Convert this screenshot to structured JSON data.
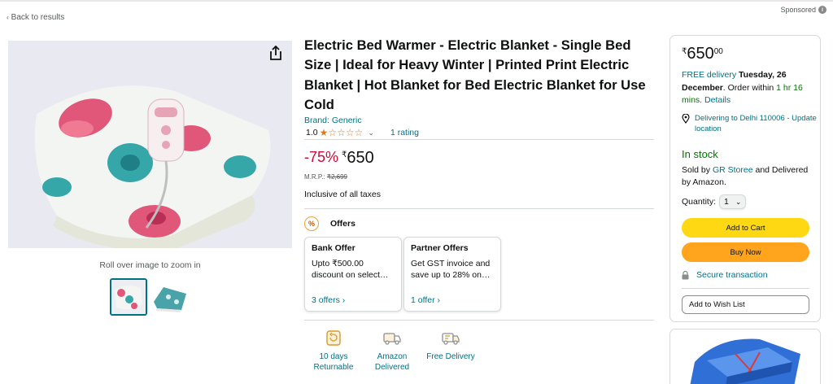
{
  "nav": {
    "back_label": "Back to results",
    "sponsored_label": "Sponsored"
  },
  "gallery": {
    "zoom_hint": "Roll over image to zoom in"
  },
  "product": {
    "title": "Electric Bed Warmer - Electric Blanket - Single Bed Size | Ideal for Heavy Winter | Printed Print Electric Blanket | Hot Blanket for Bed Electric Blanket for Use Cold",
    "brand": "Brand: Generic",
    "rating_value": "1.0",
    "stars": "★☆☆☆☆",
    "rating_count": "1 rating",
    "discount": "-75%",
    "currency": "₹",
    "price": "650",
    "mrp_label": "M.R.P.:",
    "mrp_value": "₹2,699",
    "taxes": "Inclusive of all taxes"
  },
  "offers": {
    "heading": "Offers",
    "icon_text": "%",
    "cards": [
      {
        "title": "Bank Offer",
        "body": "Upto ₹500.00 discount on select…",
        "link": "3 offers ›"
      },
      {
        "title": "Partner Offers",
        "body": "Get GST invoice and save up to 28% on…",
        "link": "1 offer ›"
      }
    ]
  },
  "features": [
    {
      "icon": "returnable-icon",
      "label_line1": "10 days",
      "label_line2": "Returnable"
    },
    {
      "icon": "amazon-delivered-icon",
      "label_line1": "Amazon",
      "label_line2": "Delivered"
    },
    {
      "icon": "free-delivery-icon",
      "label_line1": "Free Delivery",
      "label_line2": ""
    }
  ],
  "buybox": {
    "currency": "₹",
    "price_whole": "650",
    "price_fraction": "00",
    "free_delivery": "FREE delivery",
    "delivery_date": "Tuesday, 26 December",
    "order_within": ". Order within",
    "countdown": "1 hr 16 mins",
    "details_link": "Details",
    "location": "Delivering to Delhi 110006 - Update location",
    "stock": "In stock",
    "sold_by_prefix": "Sold by",
    "seller": "GR Storee",
    "sold_by_suffix": "and Delivered by Amazon.",
    "quantity_label": "Quantity:",
    "quantity_value": "1",
    "add_to_cart": "Add to Cart",
    "buy_now": "Buy Now",
    "secure": "Secure transaction",
    "wishlist": "Add to Wish List"
  },
  "colors": {
    "link": "#007185",
    "deal_red": "#cc0c39",
    "in_stock_green": "#007600",
    "cart_yellow": "#ffd814",
    "buy_orange": "#ffa41c",
    "star_orange": "#de7921"
  }
}
